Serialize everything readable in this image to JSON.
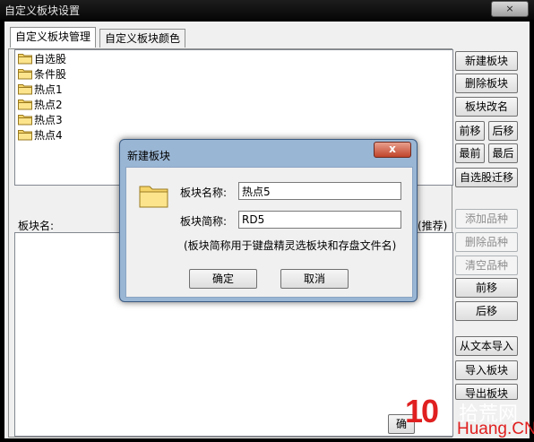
{
  "window": {
    "title": "自定义板块设置",
    "close_label": "×"
  },
  "tabs": [
    {
      "label": "自定义板块管理"
    },
    {
      "label": "自定义板块颜色"
    }
  ],
  "blocks": [
    {
      "label": "自选股"
    },
    {
      "label": "条件股"
    },
    {
      "label": "热点1"
    },
    {
      "label": "热点2"
    },
    {
      "label": "热点3"
    },
    {
      "label": "热点4"
    }
  ],
  "panel": {
    "block_name_label": "板块名:",
    "recommend_label": "(推荐)"
  },
  "buttons": {
    "new_block": "新建板块",
    "delete_block": "删除板块",
    "rename_block": "板块改名",
    "move_up": "前移",
    "move_down": "后移",
    "first": "最前",
    "last": "最后",
    "migrate": "自选股迁移",
    "add_item": "添加品种",
    "delete_item": "删除品种",
    "clear_items": "清空品种",
    "item_up": "前移",
    "item_down": "后移",
    "import_text": "从文本导入",
    "import_block": "导入板块",
    "export_block": "导出板块",
    "ok_partial": "确"
  },
  "dialog": {
    "title": "新建板块",
    "close_label": "x",
    "name_label": "板块名称:",
    "name_value": "热点5",
    "short_label": "板块简称:",
    "short_value": "RD5",
    "note": "(板块简称用于键盘精灵选板块和存盘文件名)",
    "ok": "确定",
    "cancel": "取消"
  },
  "watermark": {
    "number": "10",
    "cn": "拾荒网",
    "en": "Huang.CN"
  },
  "colors": {
    "folder": "#f5d46a",
    "accent_red": "#e02020"
  }
}
